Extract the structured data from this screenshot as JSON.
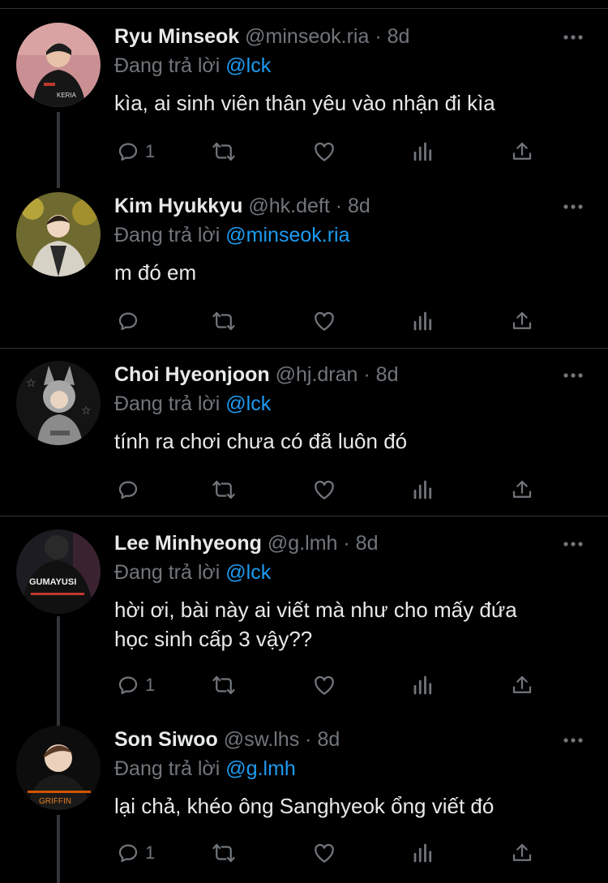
{
  "tweets": [
    {
      "name": "Ryu Minseok",
      "handle": "@minseok.ria",
      "dot": "·",
      "time": "8d",
      "reply_prefix": "Đang trả lời",
      "reply_to": "@lck",
      "text": "kìa, ai sinh viên thân yêu vào nhận đi kìa",
      "reply_count": "1",
      "avatar_icon": "avatar-photo"
    },
    {
      "name": "Kim Hyukkyu",
      "handle": "@hk.deft",
      "dot": "·",
      "time": "8d",
      "reply_prefix": "Đang trả lời",
      "reply_to": "@minseok.ria",
      "text": "m đó em",
      "reply_count": "",
      "avatar_icon": "avatar-photo"
    },
    {
      "name": "Choi Hyeonjoon",
      "handle": "@hj.dran",
      "dot": "·",
      "time": "8d",
      "reply_prefix": "Đang trả lời",
      "reply_to": "@lck",
      "text": "tính ra chơi chưa có đã luôn đó",
      "reply_count": "",
      "avatar_icon": "avatar-photo"
    },
    {
      "name": "Lee Minhyeong",
      "handle": "@g.lmh",
      "dot": "·",
      "time": "8d",
      "reply_prefix": "Đang trả lời",
      "reply_to": "@lck",
      "text_line1": "hời ơi, bài này ai viết mà như cho mấy đứa",
      "text_line2": "học sinh cấp 3 vậy??",
      "reply_count": "1",
      "avatar_icon": "avatar-photo"
    },
    {
      "name": "Son Siwoo",
      "handle": "@sw.lhs",
      "dot": "·",
      "time": "8d",
      "reply_prefix": "Đang trả lời",
      "reply_to": "@g.lmh",
      "text": "lại chả, khéo ông Sanghyeok ổng viết đó",
      "reply_count": "1",
      "avatar_icon": "avatar-photo"
    }
  ],
  "avatar_texts": {
    "t1_shirt": "KERIA",
    "t4_shirt": "GUMAYUSI",
    "t5_shirt": "GRIFFIN"
  },
  "colors": {
    "background": "#000000",
    "text": "#e7e9ea",
    "muted": "#71767b",
    "accent": "#1d9bf0",
    "divider": "#2f3336"
  },
  "action_icons": [
    "reply-icon",
    "retweet-icon",
    "like-icon",
    "stats-icon",
    "share-icon"
  ]
}
